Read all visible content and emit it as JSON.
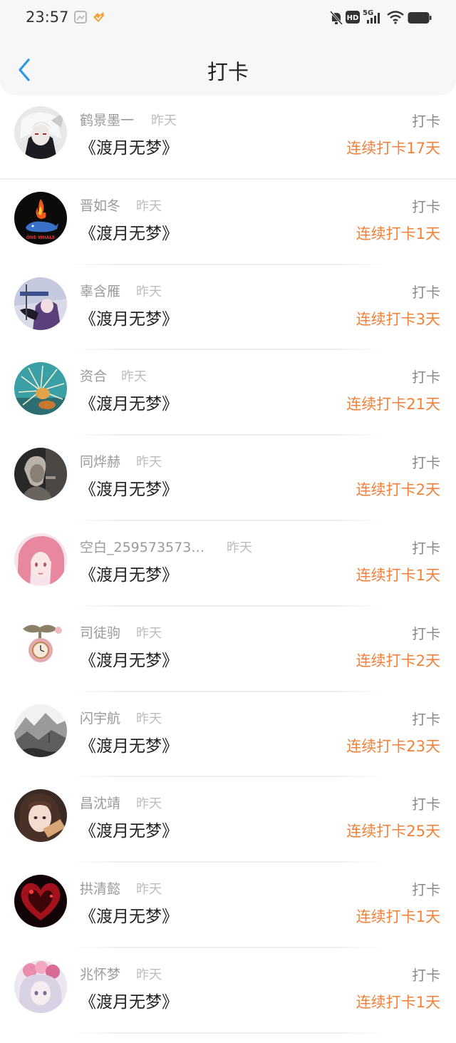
{
  "status_bar": {
    "time": "23:57",
    "icons": [
      "image-notification-icon",
      "app-notification-icon",
      "mute-icon",
      "hd-icon",
      "signal-5g-icon",
      "wifi-icon",
      "battery-icon"
    ]
  },
  "nav": {
    "title": "打卡",
    "back_icon": "chevron-left-icon"
  },
  "colors": {
    "accent": "#f3813a",
    "back": "#2b96e8"
  },
  "entries": [
    {
      "name": "鹤景墨一",
      "date": "昨天",
      "book": "《渡月无梦》",
      "checkin": "打卡",
      "streak": "连续打卡17天"
    },
    {
      "name": "晋如冬",
      "date": "昨天",
      "book": "《渡月无梦》",
      "checkin": "打卡",
      "streak": "连续打卡1天"
    },
    {
      "name": "辜含雁",
      "date": "昨天",
      "book": "《渡月无梦》",
      "checkin": "打卡",
      "streak": "连续打卡3天"
    },
    {
      "name": "资合",
      "date": "昨天",
      "book": "《渡月无梦》",
      "checkin": "打卡",
      "streak": "连续打卡21天"
    },
    {
      "name": "同烨赫",
      "date": "昨天",
      "book": "《渡月无梦》",
      "checkin": "打卡",
      "streak": "连续打卡2天"
    },
    {
      "name": "空白_259573573…",
      "date": "昨天",
      "book": "《渡月无梦》",
      "checkin": "打卡",
      "streak": "连续打卡1天"
    },
    {
      "name": "司徒驹",
      "date": "昨天",
      "book": "《渡月无梦》",
      "checkin": "打卡",
      "streak": "连续打卡2天"
    },
    {
      "name": "闪宇航",
      "date": "昨天",
      "book": "《渡月无梦》",
      "checkin": "打卡",
      "streak": "连续打卡23天"
    },
    {
      "name": "昌沈靖",
      "date": "昨天",
      "book": "《渡月无梦》",
      "checkin": "打卡",
      "streak": "连续打卡25天"
    },
    {
      "name": "拱清懿",
      "date": "昨天",
      "book": "《渡月无梦》",
      "checkin": "打卡",
      "streak": "连续打卡1天"
    },
    {
      "name": "兆怀梦",
      "date": "昨天",
      "book": "《渡月无梦》",
      "checkin": "打卡",
      "streak": "连续打卡1天"
    }
  ]
}
